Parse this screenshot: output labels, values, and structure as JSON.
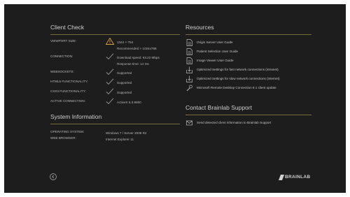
{
  "client_check": {
    "title": "Client Check",
    "rows": [
      {
        "label": "VIEWPORT SIZE:",
        "status": "warning",
        "value": "1344 × 754",
        "value2": "Recommended > 1024x768"
      },
      {
        "label": "CONNECTION:",
        "status": "ok",
        "value": "Download speed: 63.22 Mbps",
        "value2": "Response time: 14 ms"
      },
      {
        "label": "WEBSOCKETS:",
        "status": "ok",
        "value": "Supported"
      },
      {
        "label": "HTML5 FUNCTIONALITY:",
        "status": "ok",
        "value": "Supported"
      },
      {
        "label": "CSS3 FUNCTIONALITY:",
        "status": "ok",
        "value": "Supported"
      },
      {
        "label": "ACTIVE CONNECTION:",
        "status": "ok",
        "value": "ActiveX 6.3.9600"
      }
    ]
  },
  "system_info": {
    "title": "System Information",
    "rows": [
      {
        "label": "OPERATING SYSTEM:",
        "value": "Windows 7 / Server 2008 R2"
      },
      {
        "label": "WEB BROWSER:",
        "value": "Internet Explorer 11"
      }
    ]
  },
  "resources": {
    "title": "Resources",
    "items": [
      {
        "icon": "document-icon",
        "label": "Origin Server User Guide"
      },
      {
        "icon": "document-icon",
        "label": "Patient Selection User Guide"
      },
      {
        "icon": "document-icon",
        "label": "Image Viewer User Guide"
      },
      {
        "icon": "download-icon",
        "label": "Optimized Settings for fast network connections (intranet)"
      },
      {
        "icon": "download-icon",
        "label": "Optimized Settings for slow network connections (internet)"
      },
      {
        "icon": "wrench-icon",
        "label": "Microsoft Remote Desktop Connection 8.1 client update"
      }
    ]
  },
  "support": {
    "title": "Contact Brainlab Support",
    "item": {
      "icon": "envelope-icon",
      "label": "Send detected client information to Brainlab Support"
    }
  },
  "footer": {
    "back_icon": "back-arrow-icon",
    "logo_text": "BRAINLAB"
  },
  "colors": {
    "background": "#1d1d1d",
    "divider": "#7a6a3c",
    "warning": "#d9a23a",
    "ok": "#9a9a9a"
  }
}
